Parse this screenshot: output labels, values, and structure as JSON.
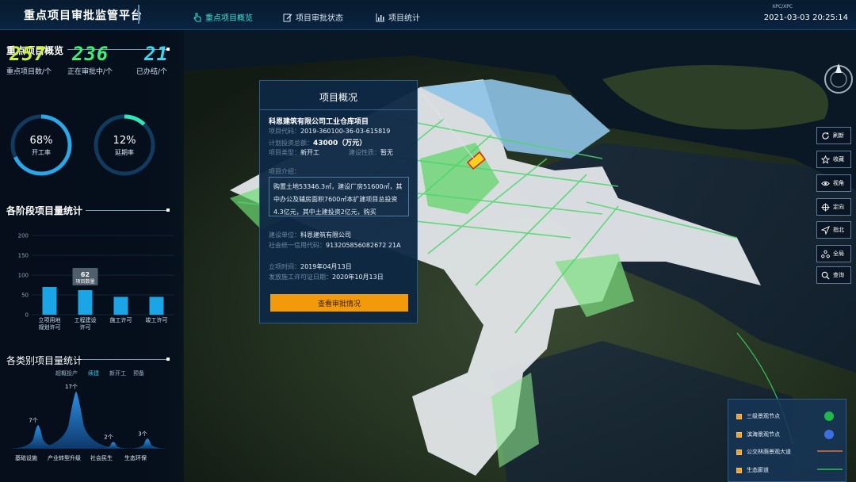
{
  "header": {
    "app_title": "重点项目审批监管平台",
    "tabs": [
      {
        "label": "重点项目概览",
        "active": true,
        "icon": "hand-pointer-icon"
      },
      {
        "label": "项目审批状态",
        "active": false,
        "icon": "edit-icon"
      },
      {
        "label": "项目统计",
        "active": false,
        "icon": "bar-chart-icon"
      }
    ],
    "small_text": "XPC/XPC",
    "datetime": "2021-03-03 20:25:14"
  },
  "overview": {
    "title": "重点项目概览",
    "stats": [
      {
        "value": "257",
        "label": "重点项目数/个",
        "color": "#c9f03a"
      },
      {
        "value": "236",
        "label": "正在审批中/个",
        "color": "#3af07a"
      },
      {
        "value": "21",
        "label": "已办结/个",
        "color": "#3ad8f0"
      }
    ],
    "rings": [
      {
        "value": "68%",
        "label": "开工率",
        "fraction": 0.68,
        "color": "#2aa7e8"
      },
      {
        "value": "12%",
        "label": "延期率",
        "fraction": 0.12,
        "color": "#2ee8b8"
      }
    ]
  },
  "stage_stats": {
    "title": "各阶段项目量统计",
    "chart_data": {
      "type": "bar",
      "categories": [
        "立项用地规划许可",
        "工程建设许可",
        "施工许可",
        "竣工许可"
      ],
      "category_lines": [
        [
          "立项用地",
          "规划许可"
        ],
        [
          "工程建设",
          "许可"
        ],
        [
          "施工许可"
        ],
        [
          "竣工许可"
        ]
      ],
      "values": [
        70,
        62,
        45,
        45
      ],
      "ylim": [
        0,
        200
      ],
      "yticks": [
        0,
        50,
        100,
        150,
        200
      ],
      "highlight_index": 1,
      "tooltip": {
        "value": "62",
        "label": "项目数量"
      },
      "color": "#1aa6e6"
    }
  },
  "category_stats": {
    "title": "各类别项目量统计",
    "filters": [
      {
        "label": "超概投产",
        "active": false
      },
      {
        "label": "续建",
        "active": true
      },
      {
        "label": "新开工",
        "active": false
      },
      {
        "label": "预备",
        "active": false
      }
    ],
    "chart_data": {
      "type": "area",
      "categories": [
        "基础设施",
        "产业转型升级",
        "社会民生",
        "生态环保"
      ],
      "peaks": [
        {
          "x": "基础设施",
          "value": 7,
          "label": "7个"
        },
        {
          "x": "产业转型升级",
          "value": 17,
          "label": "17个"
        },
        {
          "x": "社会民生",
          "value": 2,
          "label": "2个"
        },
        {
          "x": "生态环保",
          "value": 3,
          "label": "3个"
        }
      ],
      "color": "#1c7fd6"
    }
  },
  "popup": {
    "title": "项目概况",
    "project_name": "科恩建筑有限公司工业仓库项目",
    "code_label": "项目代码：",
    "code_value": "2019-360100-36-03-615819",
    "investment_label": "计划投资总额：",
    "investment_value": "43000（万元）",
    "type_label": "项目类型：",
    "type_value": "新开工",
    "nature_label": "建设性质：",
    "nature_value": "暂无",
    "intro_label": "项目介绍：",
    "intro_text": "购置土地53346.3㎡，建设厂房51600㎡，其中办公及辅房面积7600㎡本扩建项目总投资4.3亿元，其中土建投资2亿元，购买",
    "unit_label": "建设单位：",
    "unit_value": "科恩建筑有限公司",
    "credit_label": "社会统一信用代码：",
    "credit_value": "913205856082672 21A",
    "approval_label": "立项时间：",
    "approval_value": "2019年04月13日",
    "permit_label": "发放施工许可证日期：",
    "permit_value": "2020年10月13日",
    "button_label": "查看审批情况"
  },
  "toolbar": [
    {
      "label": "刷新",
      "icon": "refresh-icon"
    },
    {
      "label": "收藏",
      "icon": "star-icon"
    },
    {
      "label": "视角",
      "icon": "eye-icon"
    },
    {
      "label": "定向",
      "icon": "crosshair-icon"
    },
    {
      "label": "指北",
      "icon": "north-arrow-icon"
    },
    {
      "label": "全局",
      "icon": "network-icon"
    },
    {
      "label": "查询",
      "icon": "search-icon"
    }
  ],
  "map_legend": [
    {
      "label": "三级景观节点",
      "marker": "circle",
      "color": "#1fb84a"
    },
    {
      "label": "滨海景观节点",
      "marker": "circle",
      "color": "#3d6fe0"
    },
    {
      "label": "公交林荫景观大道",
      "marker": "line",
      "color": "#e0733a"
    },
    {
      "label": "生态廊道",
      "marker": "line",
      "color": "#2ec24a"
    }
  ]
}
